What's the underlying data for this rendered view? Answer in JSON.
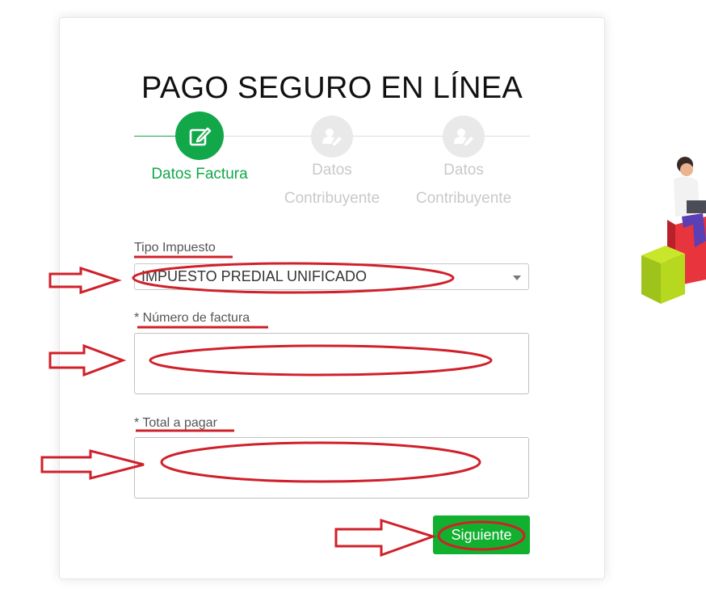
{
  "page": {
    "title": "PAGO SEGURO EN LÍNEA"
  },
  "steps": [
    {
      "label": "Datos Factura",
      "state": "active",
      "icon": "edit-icon"
    },
    {
      "label": "Datos Contribuyente",
      "state": "pending",
      "icon": "user-edit-icon"
    },
    {
      "label": "Datos Contribuyente",
      "state": "pending",
      "icon": "user-edit-icon"
    }
  ],
  "form": {
    "tipo_impuesto": {
      "label": "Tipo Impuesto",
      "value": "IMPUESTO PREDIAL UNIFICADO"
    },
    "numero_factura": {
      "label": "* Número de factura",
      "value": ""
    },
    "total_pagar": {
      "label": "* Total a pagar",
      "value": ""
    },
    "submit_label": "Siguiente"
  },
  "colors": {
    "accent_green": "#12a84a",
    "button_green": "#12b02f",
    "annotation_red": "#d0202a",
    "inactive_gray": "#c9c9c9"
  },
  "illustration": {
    "icon": "person-on-boxes-illustration"
  }
}
